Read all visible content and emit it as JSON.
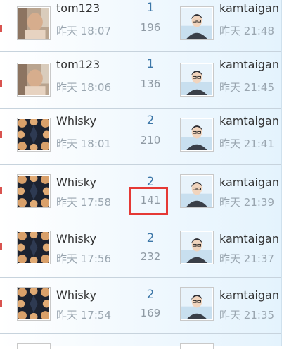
{
  "threads": [
    {
      "author": "tom123",
      "avatar": "photo-avatar",
      "posted": "昨天 18:07",
      "replies": "1",
      "views": "196",
      "last_user": "kamtaigan",
      "last_avatar": "cartoon-avatar",
      "last_time": "昨天 21:48"
    },
    {
      "author": "tom123",
      "avatar": "photo-avatar",
      "posted": "昨天 18:06",
      "replies": "1",
      "views": "136",
      "last_user": "kamtaigan",
      "last_avatar": "cartoon-avatar",
      "last_time": "昨天 21:45"
    },
    {
      "author": "Whisky",
      "avatar": "pattern-avatar",
      "posted": "昨天 18:01",
      "replies": "2",
      "views": "210",
      "last_user": "kamtaigan",
      "last_avatar": "cartoon-avatar",
      "last_time": "昨天 21:41"
    },
    {
      "author": "Whisky",
      "avatar": "pattern-avatar",
      "posted": "昨天 17:58",
      "replies": "2",
      "views": "141",
      "last_user": "kamtaigan",
      "last_avatar": "cartoon-avatar",
      "last_time": "昨天 21:39"
    },
    {
      "author": "Whisky",
      "avatar": "pattern-avatar",
      "posted": "昨天 17:56",
      "replies": "2",
      "views": "232",
      "last_user": "kamtaigan",
      "last_avatar": "cartoon-avatar",
      "last_time": "昨天 21:37"
    },
    {
      "author": "Whisky",
      "avatar": "pattern-avatar",
      "posted": "昨天 17:54",
      "replies": "2",
      "views": "169",
      "last_user": "kamtaigan",
      "last_avatar": "cartoon-avatar",
      "last_time": "昨天 21:35"
    }
  ],
  "colors": {
    "highlight": "#e53935",
    "reply_count": "#3d77a8",
    "time": "#9aa6b0",
    "row_border": "#c7d3dd"
  }
}
